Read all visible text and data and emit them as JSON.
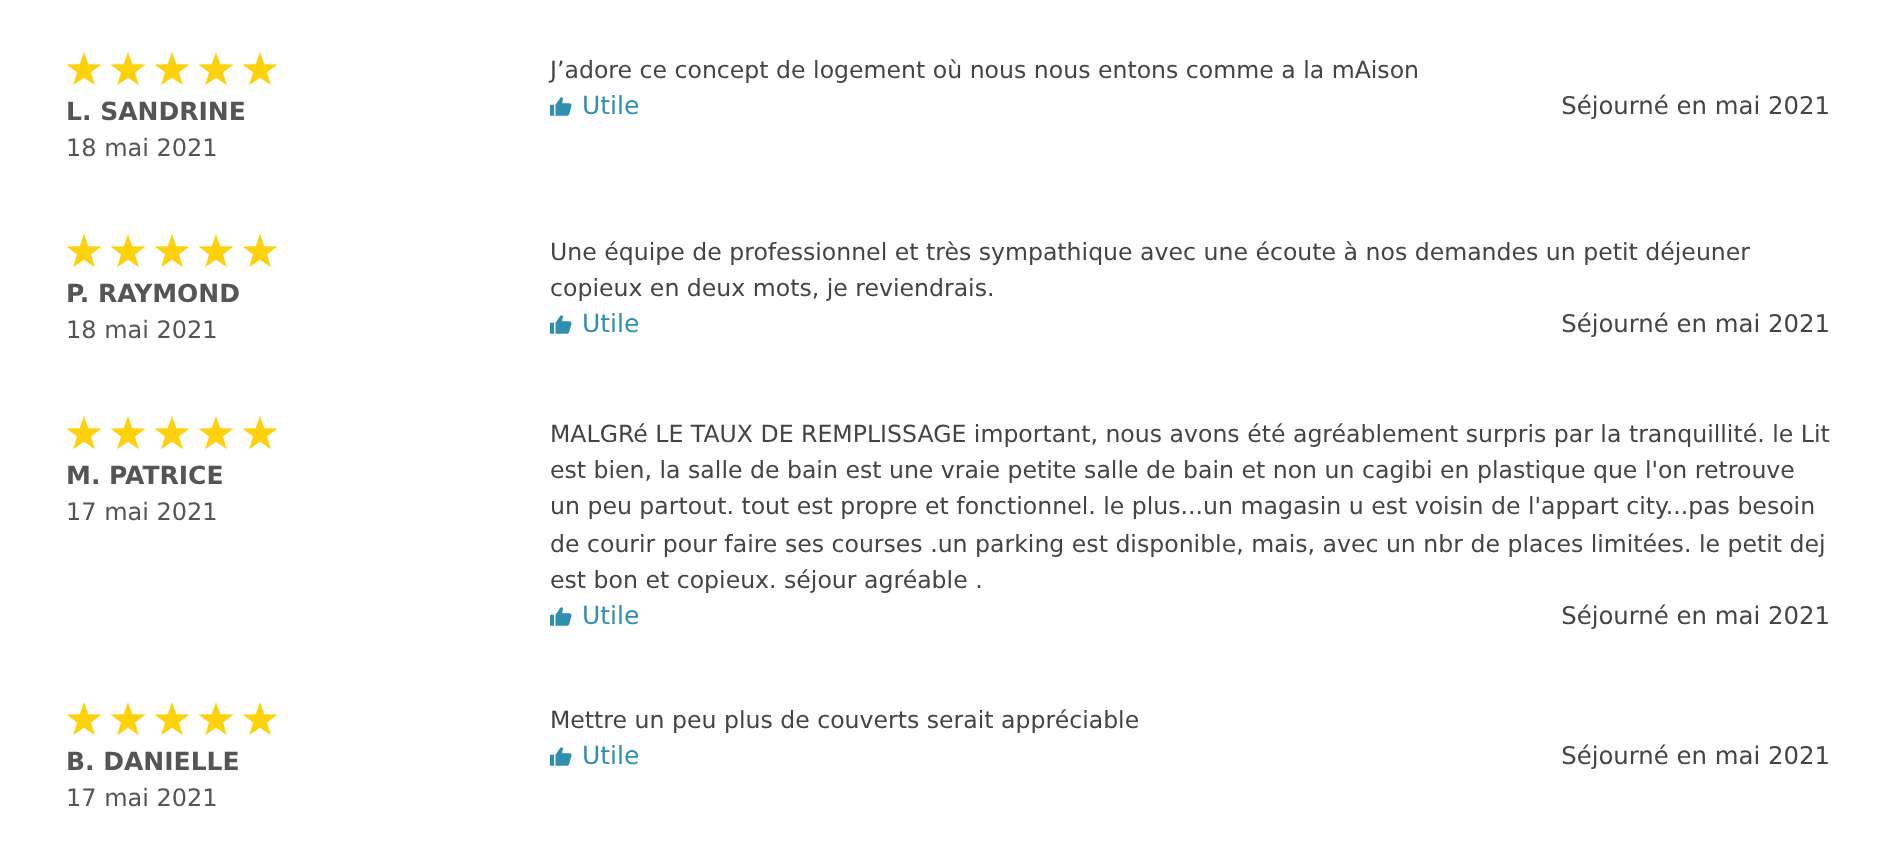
{
  "reviews": [
    {
      "stars": 5,
      "author": "L. SANDRINE",
      "date": "18 mai 2021",
      "text": "J’adore ce concept de logement où nous nous entons comme a la mAison",
      "helpful": "Utile",
      "stay": "Séjourné en mai 2021"
    },
    {
      "stars": 5,
      "author": "P. RAYMOND",
      "date": "18 mai 2021",
      "text": "Une équipe de professionnel et très sympathique avec une écoute à nos demandes un petit déjeuner copieux en deux mots, je reviendrais.",
      "helpful": "Utile",
      "stay": "Séjourné en mai 2021"
    },
    {
      "stars": 5,
      "author": "M. PATRICE",
      "date": "17 mai 2021",
      "text": "MALGRé LE TAUX DE REMPLISSAGE important, nous avons été agréablement surpris par la tranquillité. le Lit est bien, la salle de bain est une vraie petite salle de bain et non un cagibi en plastique que l'on retrouve un peu partout. tout est propre et fonctionnel. le plus...un magasin u est voisin de l'appart city...pas besoin de courir pour faire ses courses .un parking est disponible, mais, avec un nbr de places limitées. le petit dej est bon et copieux. séjour agréable .",
      "helpful": "Utile",
      "stay": "Séjourné en mai 2021"
    },
    {
      "stars": 5,
      "author": "B. DANIELLE",
      "date": "17 mai 2021",
      "text": "Mettre un peu plus de couverts serait appréciable",
      "helpful": "Utile",
      "stay": "Séjourné en mai 2021"
    }
  ]
}
